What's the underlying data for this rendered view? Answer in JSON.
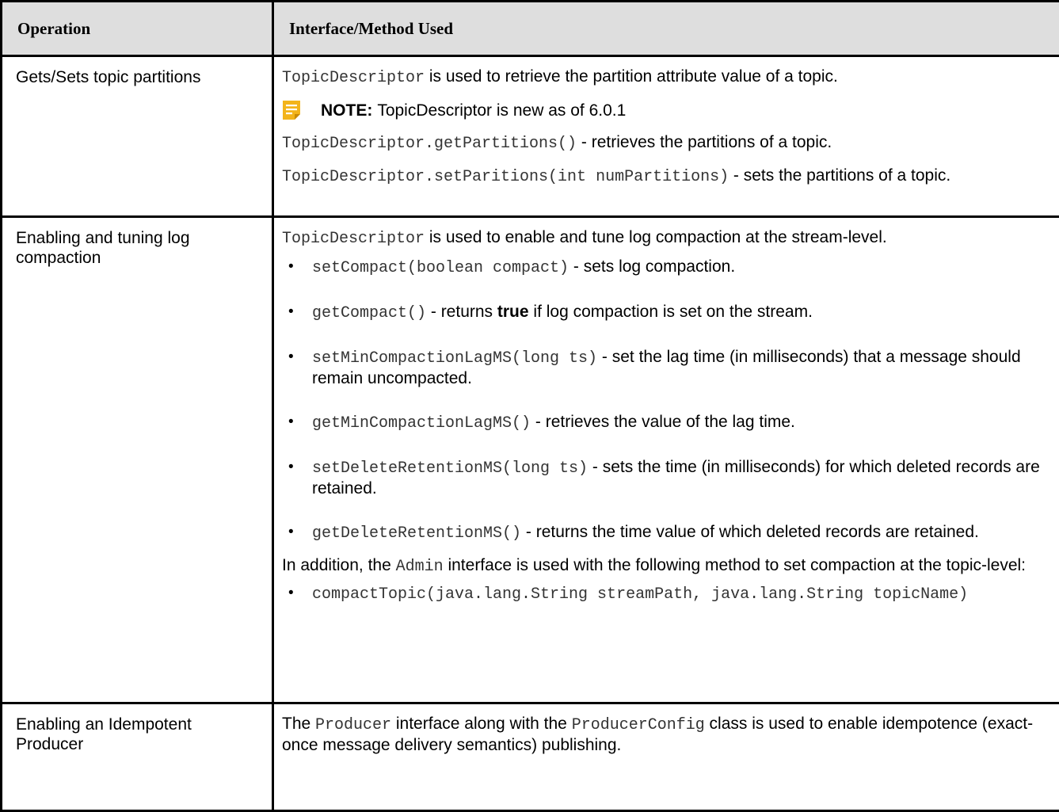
{
  "table": {
    "headers": {
      "operation": "Operation",
      "interface": "Interface/Method Used"
    },
    "rows": [
      {
        "operation": "Gets/Sets topic partitions",
        "lead_code": "TopicDescriptor",
        "lead_text": " is used to retrieve the partition attribute value of a topic.",
        "note_label": "NOTE:",
        "note_text": "TopicDescriptor is new as of 6.0.1",
        "get_code": "TopicDescriptor.getPartitions()",
        "get_text": " - retrieves the partitions of a topic.",
        "set_code": "TopicDescriptor.setParitions(int numPartitions)",
        "set_text": " - sets the partitions of a topic."
      },
      {
        "operation": "Enabling and tuning log compaction",
        "lead_code": "TopicDescriptor",
        "lead_text": " is used to enable and tune log compaction at the stream-level.",
        "items": [
          {
            "code": "setCompact(boolean compact)",
            "text": " - sets log compaction."
          },
          {
            "code": "getCompact()",
            "text_before": " - returns ",
            "bold": "true",
            "text_after": " if log compaction is set on the stream."
          },
          {
            "code": "setMinCompactionLagMS(long ts)",
            "text": " - set the lag time (in milliseconds) that a message should remain uncompacted."
          },
          {
            "code": "getMinCompactionLagMS()",
            "text": " - retrieves the value of the lag time."
          },
          {
            "code": "setDeleteRetentionMS(long ts)",
            "text": " - sets the time (in milliseconds) for which deleted records are retained."
          },
          {
            "code": "getDeleteRetentionMS()",
            "text": " - returns the time value of which deleted records are retained."
          }
        ],
        "addition_before": "In addition, the ",
        "addition_code": "Admin",
        "addition_after": " interface is used with the following method to set compaction at the topic-level:",
        "admin_item": "compactTopic(java.lang.String streamPath, java.lang.String topicName)"
      },
      {
        "operation": "Enabling an Idempotent Producer",
        "text1": "The ",
        "code1": "Producer",
        "text2": " interface along with the ",
        "code2": "ProducerConfig",
        "text3": " class is used to enable idempotence (exact-once message delivery semantics) publishing."
      }
    ]
  },
  "colors": {
    "header_bg": "#dedede",
    "border": "#000000",
    "note_icon": "#f3b41a"
  },
  "icons": {
    "note": "note-icon",
    "bullet": "•"
  }
}
